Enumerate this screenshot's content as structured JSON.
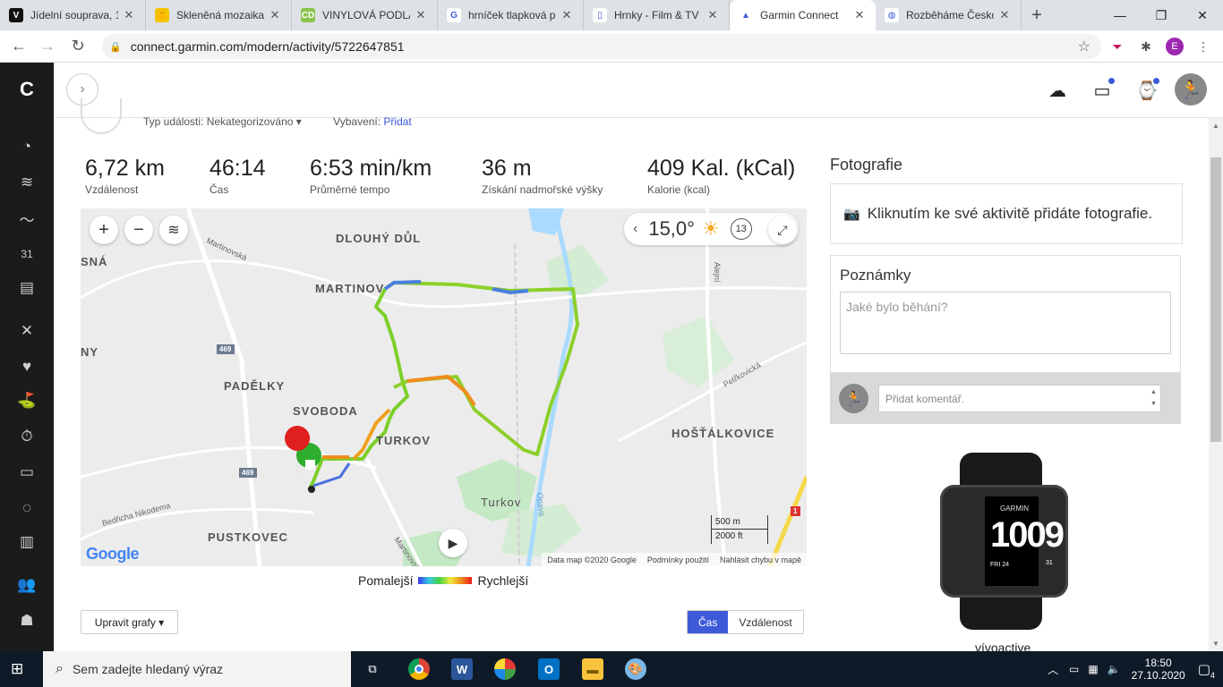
{
  "browser": {
    "tabs": [
      {
        "title": "Jídelní souprava, 1",
        "favicon": "V",
        "color": "#111111",
        "active": false
      },
      {
        "title": "Skleněná mozaika",
        "favicon": "🐥",
        "color": "#f5c400",
        "active": false
      },
      {
        "title": "VINYLOVÁ PODLAHA",
        "favicon": "CD",
        "color": "#8bc34a",
        "active": false
      },
      {
        "title": "hrníček tlapková p",
        "favicon": "G",
        "color": "#ffffff",
        "active": false
      },
      {
        "title": "Hrnky - Film & TV",
        "favicon": "▯",
        "color": "#ffffff",
        "active": false
      },
      {
        "title": "Garmin Connect",
        "favicon": "▲",
        "color": "#ffffff",
        "active": true
      },
      {
        "title": "Rozběháme Česko",
        "favicon": "◍",
        "color": "#ffffff",
        "active": false
      }
    ],
    "url": "connect.garmin.com/modern/activity/5722647851",
    "profile_initial": "E"
  },
  "activity": {
    "event_type_label": "Typ události:",
    "event_type_value": "Nekategorizováno",
    "equipment_label": "Vybavení:",
    "equipment_link": "Přidat",
    "stats": [
      {
        "value": "6,72 km",
        "label": "Vzdálenost"
      },
      {
        "value": "46:14",
        "label": "Čas"
      },
      {
        "value": "6:53 min/km",
        "label": "Průměrné tempo"
      },
      {
        "value": "36 m",
        "label": "Získání nadmořské výšky"
      },
      {
        "value": "409 Kal. (kCal)",
        "label": "Kalorie (kcal)"
      }
    ]
  },
  "map": {
    "temperature": "15,0°",
    "wind_speed": "13",
    "labels": [
      "DLOUHÝ DŮL",
      "MARTINOV",
      "PADĚLKY",
      "SVOBODA",
      "TURKOV",
      "HOŠŤÁLKOVICE",
      "PUSTKOVEC",
      "Turkov",
      "SNÁ",
      "NY",
      "Martinovská",
      "Bedřicha Nikodema",
      "Alejní",
      "Petřkovická",
      "Opava",
      "Martinovská"
    ],
    "road_numbers": [
      "469",
      "469",
      "1"
    ],
    "scale_m": "500 m",
    "scale_ft": "2000 ft",
    "google": "Google",
    "data_credit": "Data map ©2020 Google",
    "terms": "Podmínky použití",
    "report": "Nahlásit chybu v mapě",
    "legend_slow": "Pomalejší",
    "legend_fast": "Rychlejší"
  },
  "controls": {
    "edit_charts": "Upravit grafy ▾",
    "toggle_time": "Čas",
    "toggle_distance": "Vzdálenost"
  },
  "right": {
    "photos_title": "Fotografie",
    "photos_prompt": "Kliknutím ke své aktivitě přidáte fotografie.",
    "notes_title": "Poznámky",
    "notes_placeholder": "Jaké bylo běhání?",
    "comment_placeholder": "Přidat komentář.",
    "device_name": "vívoactive",
    "watch_time_h": "10",
    "watch_time_m": "09",
    "watch_brand": "GARMIN",
    "watch_day": "FRI 24",
    "watch_date": "31"
  },
  "taskbar": {
    "search_placeholder": "Sem zadejte hledaný výraz",
    "time": "18:50",
    "date": "27.10.2020",
    "notifications": "4"
  }
}
